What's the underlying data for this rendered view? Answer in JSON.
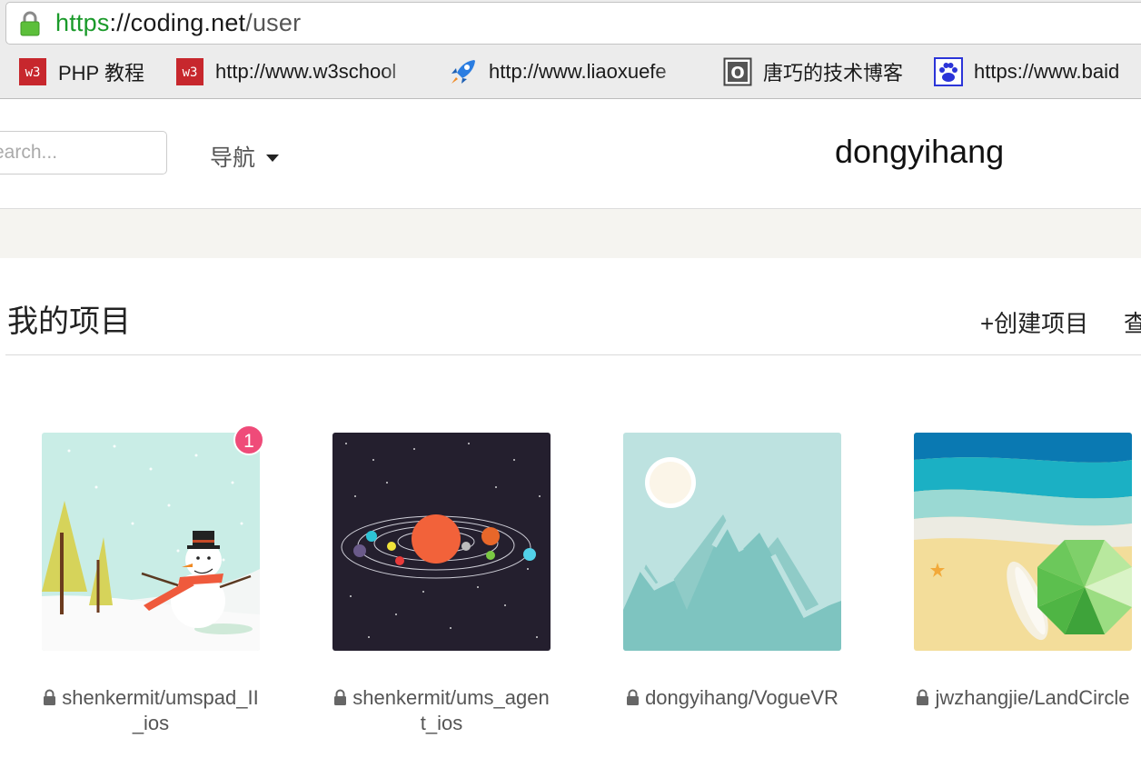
{
  "browser": {
    "url": {
      "protocol": "https",
      "separator": "://",
      "host": "coding.net",
      "path": "/user"
    },
    "bookmarks": [
      {
        "icon": "w3-icon",
        "label": "PHP 教程"
      },
      {
        "icon": "w3-icon",
        "label": "http://www.w3school"
      },
      {
        "icon": "rocket-icon",
        "label": "http://www.liaoxuefe"
      },
      {
        "icon": "o-square-icon",
        "label": "唐巧的技术博客"
      },
      {
        "icon": "paw-icon",
        "label": "https://www.baid"
      }
    ],
    "w3_icon_text": "w3",
    "o_icon_text": "O"
  },
  "header": {
    "search_placeholder": "Search...",
    "nav_label": "导航",
    "username": "dongyihang"
  },
  "main": {
    "section_title": "我的项目",
    "create_project_label": "+创建项目",
    "view_more_label": "查",
    "projects": [
      {
        "name": "shenkermit/umspad_II_ios",
        "private": true,
        "badge": "1",
        "theme": "snowman"
      },
      {
        "name": "shenkermit/ums_agent_ios",
        "private": true,
        "badge": null,
        "theme": "solar-system"
      },
      {
        "name": "dongyihang/VogueVR",
        "private": true,
        "badge": null,
        "theme": "mountains"
      },
      {
        "name": "jwzhangjie/LandCircle",
        "private": true,
        "badge": null,
        "theme": "beach"
      }
    ]
  },
  "colors": {
    "url_protocol": "#1a9a2a",
    "badge": "#ef4b79",
    "sub_band": "#f5f4f0"
  }
}
